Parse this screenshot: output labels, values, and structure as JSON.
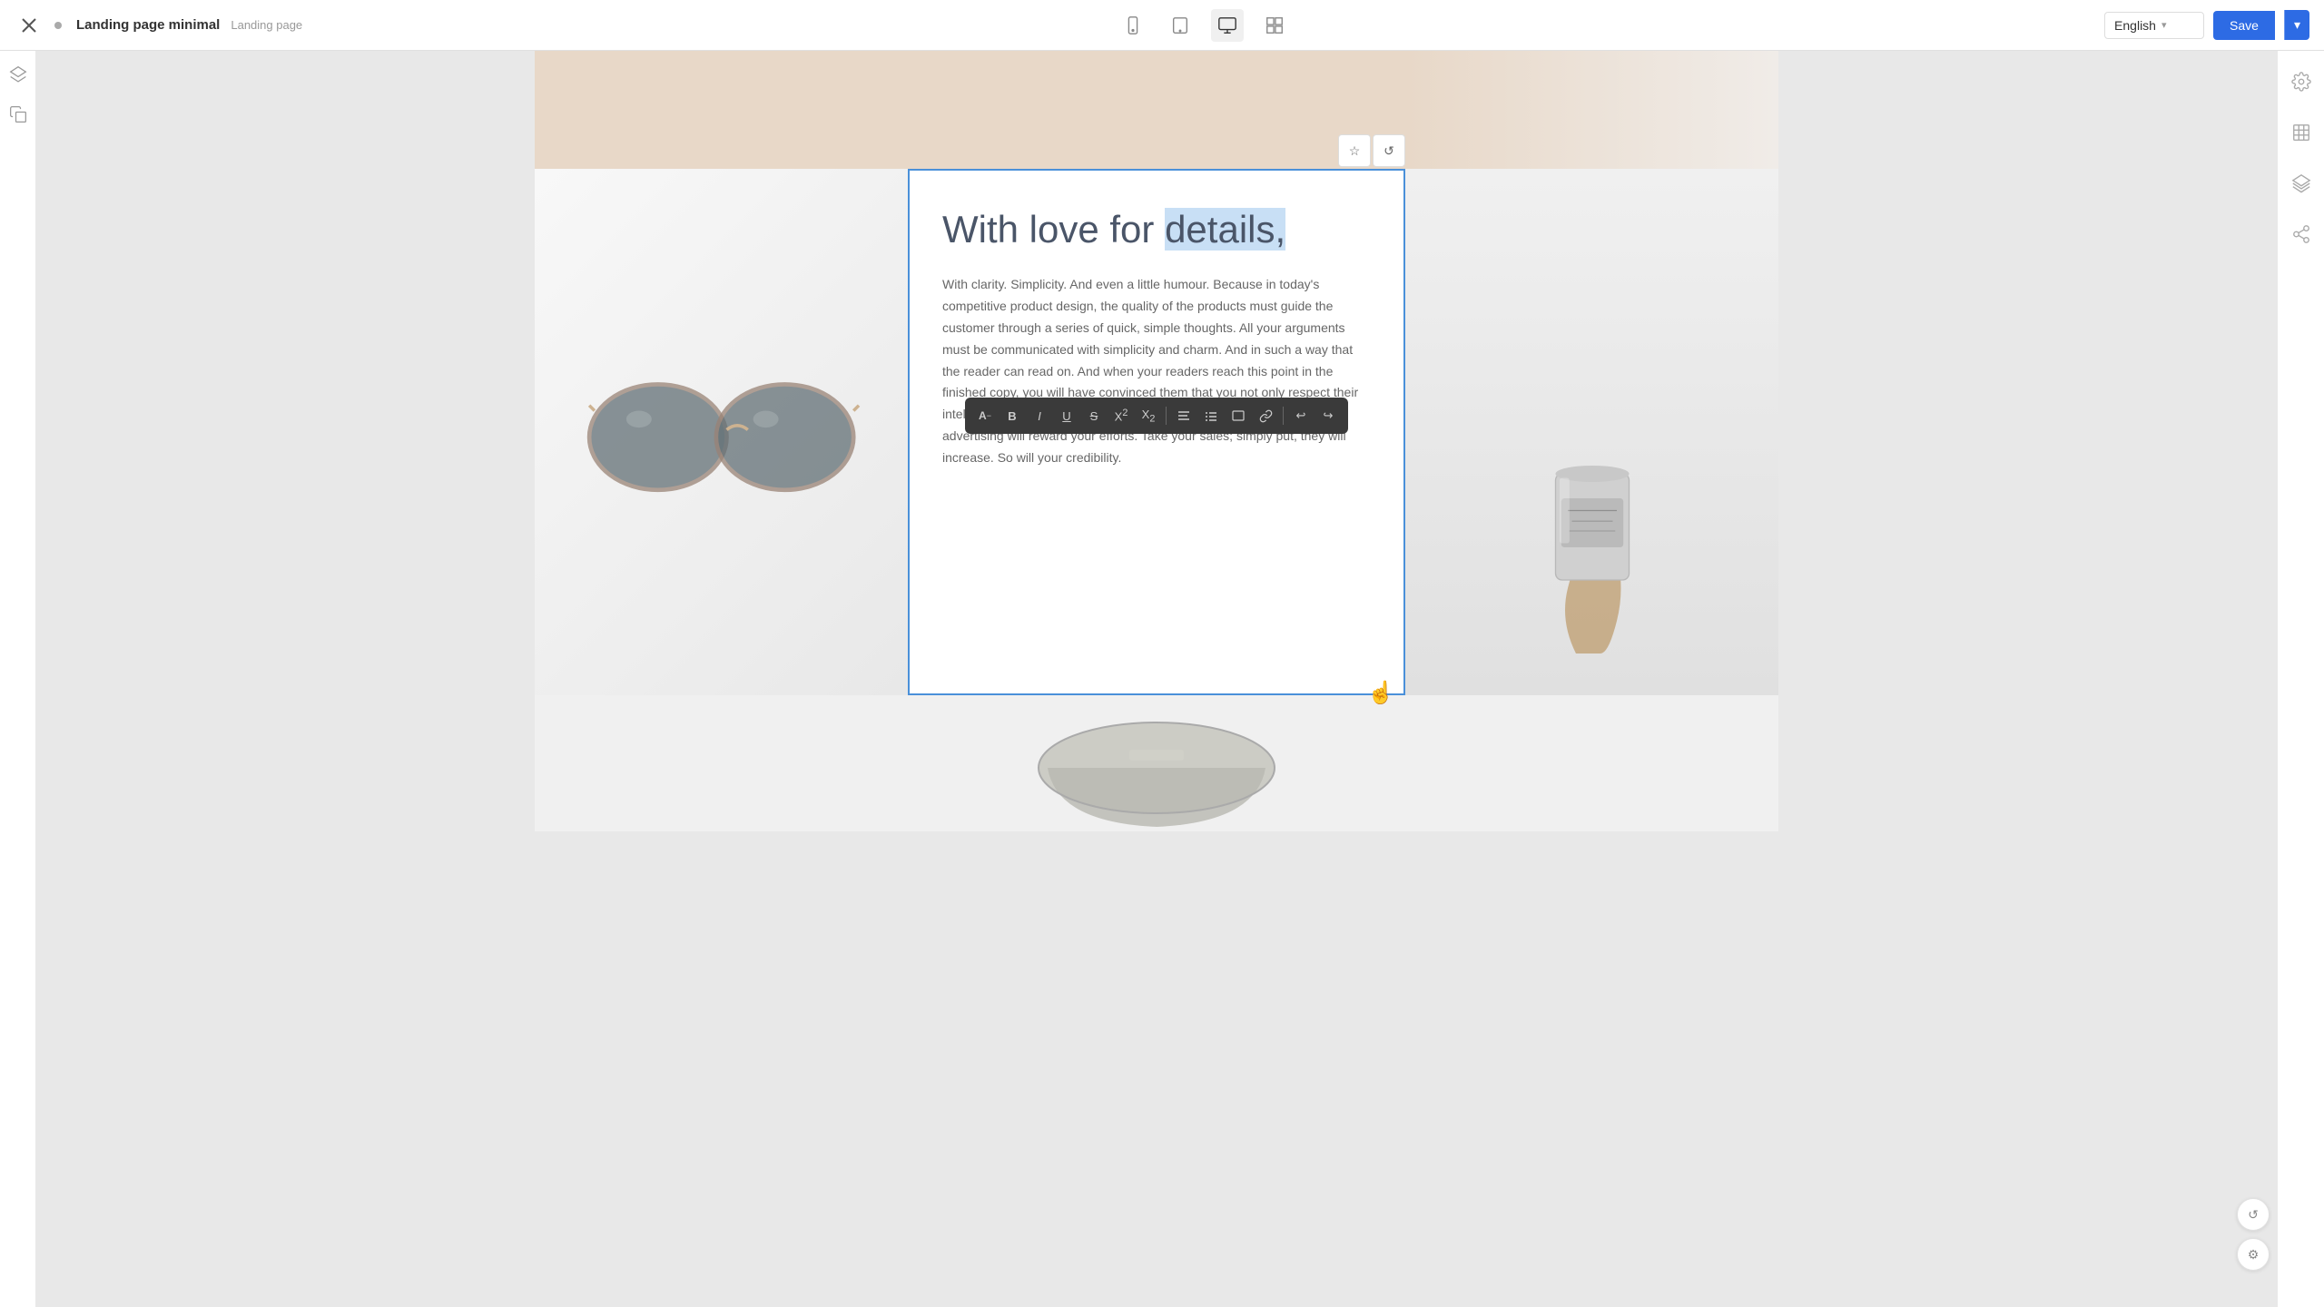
{
  "topbar": {
    "close_label": "✕",
    "page_title": "Landing page minimal",
    "page_subtitle": "Landing page",
    "devices": [
      {
        "id": "mobile",
        "label": "Mobile"
      },
      {
        "id": "tablet",
        "label": "Tablet"
      },
      {
        "id": "desktop",
        "label": "Desktop",
        "active": true
      },
      {
        "id": "list",
        "label": "List"
      }
    ],
    "language": "English",
    "save_label": "Save",
    "save_arrow": "▾"
  },
  "left_sidebar": {
    "icons": [
      {
        "id": "layers",
        "label": "Layers"
      },
      {
        "id": "duplicate",
        "label": "Duplicate"
      }
    ]
  },
  "right_sidebar": {
    "icons": [
      {
        "id": "settings",
        "label": "Settings"
      },
      {
        "id": "frame",
        "label": "Frame"
      },
      {
        "id": "layers-stack",
        "label": "Layers Stack"
      },
      {
        "id": "share",
        "label": "Share"
      }
    ]
  },
  "format_toolbar": {
    "buttons": [
      {
        "id": "font",
        "label": "A-"
      },
      {
        "id": "bold",
        "label": "B"
      },
      {
        "id": "italic",
        "label": "I"
      },
      {
        "id": "underline",
        "label": "U"
      },
      {
        "id": "strikethrough",
        "label": "S̶"
      },
      {
        "id": "superscript",
        "label": "X²"
      },
      {
        "id": "subscript",
        "label": "X₂"
      },
      {
        "id": "align",
        "label": "≡"
      },
      {
        "id": "list",
        "label": "☰"
      },
      {
        "id": "block",
        "label": "▭"
      },
      {
        "id": "link",
        "label": "🔗"
      },
      {
        "id": "undo",
        "label": "↩"
      },
      {
        "id": "redo",
        "label": "↪"
      }
    ]
  },
  "content": {
    "heading_pre": "With love for ",
    "heading_highlight": "details,",
    "body_text": "With clarity. Simplicity. And even a little humour. Because in today's competitive product design, the quality of the products must guide the customer through a series of quick, simple thoughts. All your arguments must be communicated with simplicity and charm. And in such a way that the reader can read on. And when your readers reach this point in the finished copy, you will have convinced them that you not only respect their intelligence, but also understand their needs as consumers. Your advertising will reward your efforts. Take your sales; simply put, they will increase. So will your credibility."
  },
  "block_controls": [
    {
      "id": "star",
      "label": "☆"
    },
    {
      "id": "refresh",
      "label": "↺"
    }
  ],
  "bottom_right": {
    "undo_label": "↺",
    "settings_label": "⚙"
  },
  "colors": {
    "accent": "#2d6be4",
    "highlight": "#c8dff5",
    "toolbar_bg": "#3a3a3a",
    "border": "#4a90d9"
  }
}
